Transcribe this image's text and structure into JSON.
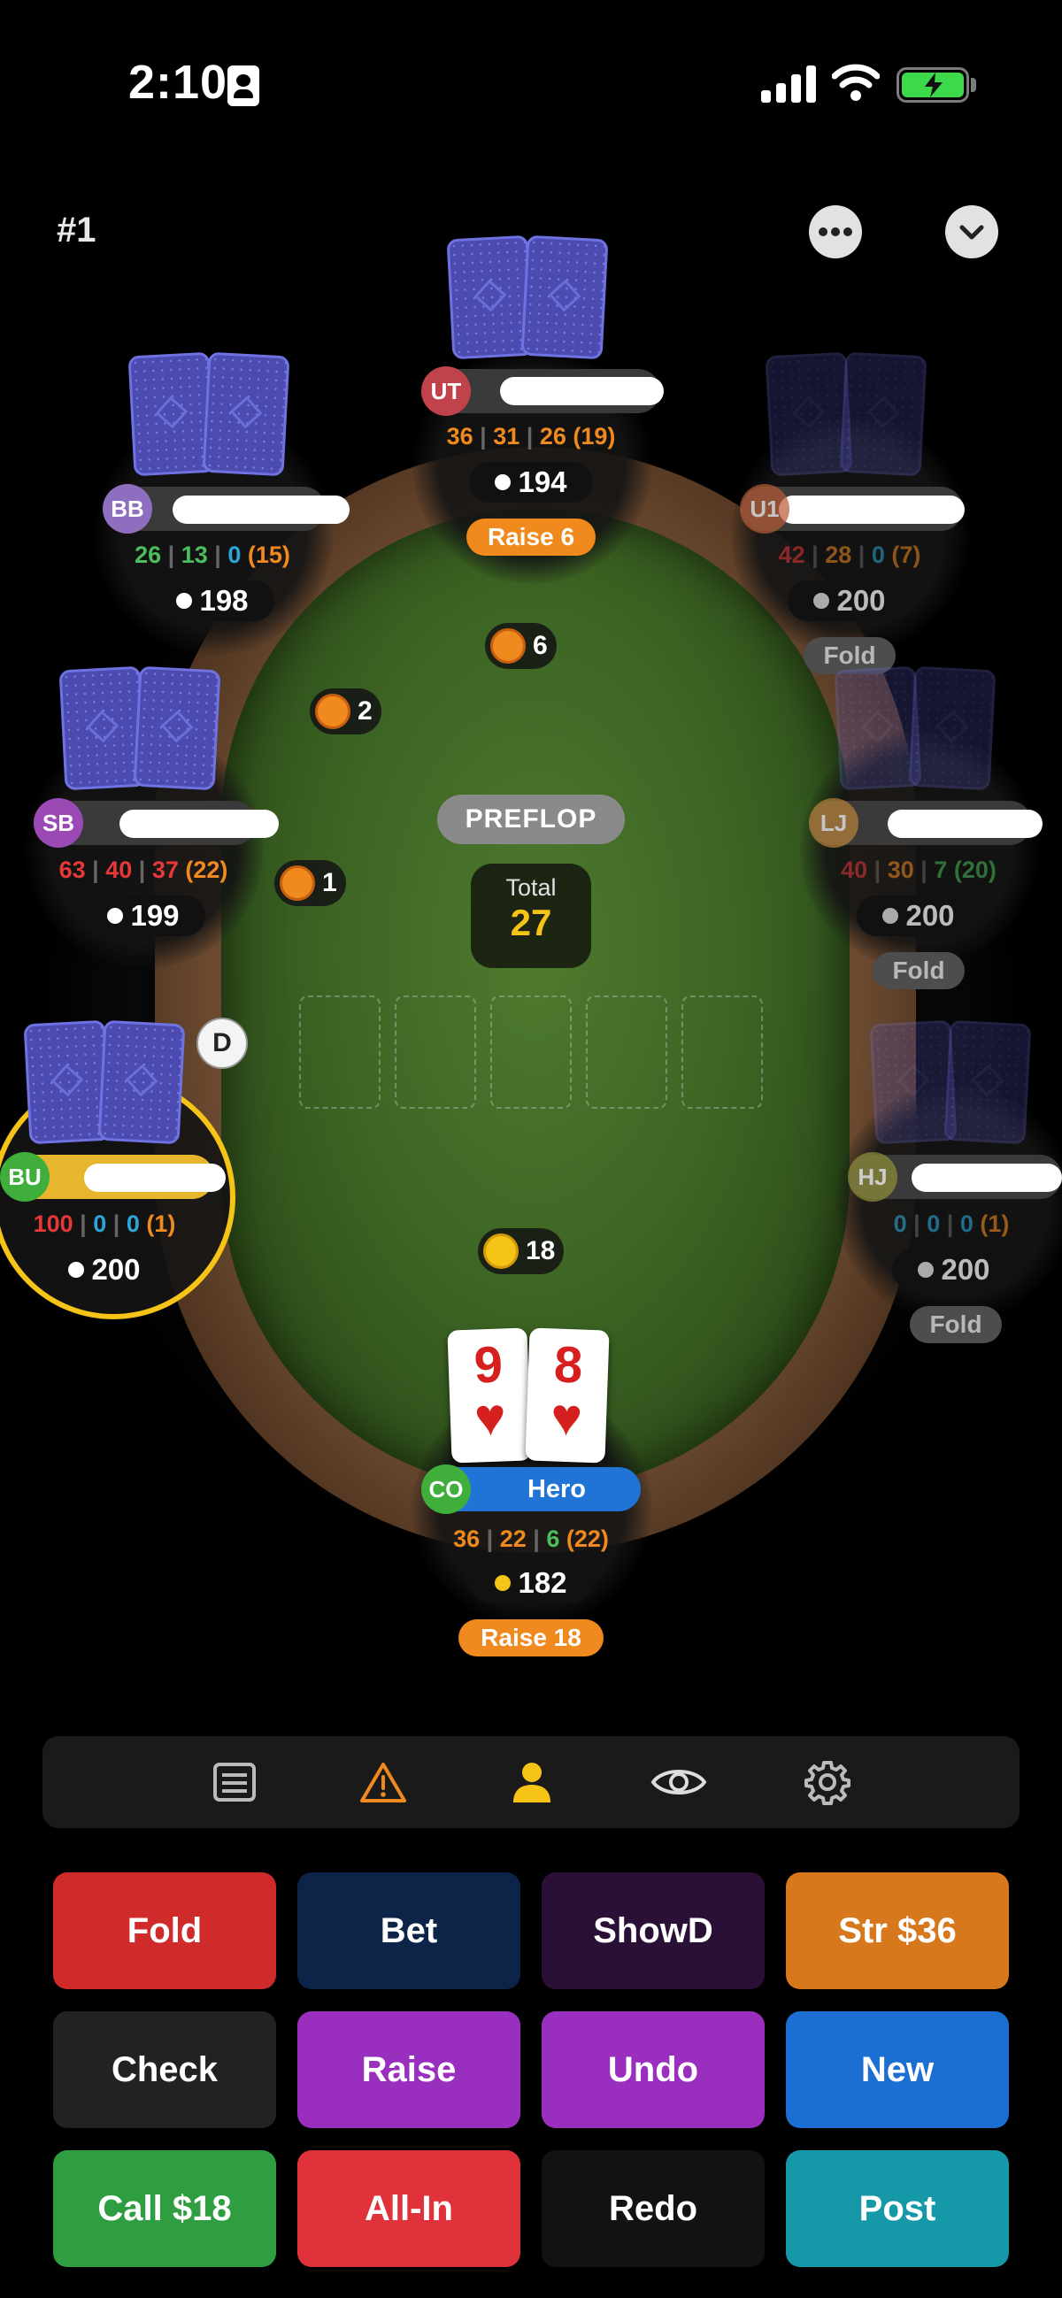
{
  "status_bar": {
    "time": "2:10",
    "battery_color": "#3cd94a"
  },
  "header": {
    "hand_number": "#1",
    "more_icon": "ellipsis-icon",
    "collapse_icon": "chevron-down-icon"
  },
  "street": "PREFLOP",
  "pot": {
    "label": "Total",
    "value": "27"
  },
  "dealer": "D",
  "seats": {
    "ut": {
      "position": "UT",
      "stats": [
        "36",
        "31",
        "26",
        "(19)"
      ],
      "stack": "194",
      "action": "Raise 6",
      "badge_color": "#c0434b"
    },
    "bb": {
      "position": "BB",
      "stats": [
        "26",
        "13",
        "0",
        "(15)"
      ],
      "stack": "198",
      "badge_color": "#8e6fbf"
    },
    "u1": {
      "position": "U1",
      "stats": [
        "42",
        "28",
        "0",
        "(7)"
      ],
      "stack": "200",
      "action": "Fold",
      "badge_color": "#b85a35"
    },
    "sb": {
      "position": "SB",
      "stats": [
        "63",
        "40",
        "37",
        "(22)"
      ],
      "stack": "199",
      "badge_color": "#9a49b5"
    },
    "lj": {
      "position": "LJ",
      "stats": [
        "40",
        "30",
        "7",
        "(20)"
      ],
      "stack": "200",
      "action": "Fold",
      "badge_color": "#b8833a"
    },
    "bu": {
      "position": "BU",
      "stats": [
        "100",
        "0",
        "0",
        "(1)"
      ],
      "stack": "200",
      "badge_color": "#3fae3a"
    },
    "hj": {
      "position": "HJ",
      "stats": [
        "0",
        "0",
        "0",
        "(1)"
      ],
      "stack": "200",
      "action": "Fold",
      "badge_color": "#8a8a3a"
    },
    "co": {
      "position": "CO",
      "name": "Hero",
      "stats": [
        "36",
        "22",
        "6",
        "(22)"
      ],
      "stack": "182",
      "action": "Raise 18",
      "badge_color": "#3fae3a",
      "cards": [
        {
          "rank": "9",
          "suit": "♥"
        },
        {
          "rank": "8",
          "suit": "♥"
        }
      ]
    }
  },
  "bets": {
    "ut": "6",
    "bb": "2",
    "sb": "1",
    "hero": "18"
  },
  "toolbar": [
    "notes-icon",
    "warning-icon",
    "person-icon",
    "eye-icon",
    "gear-icon"
  ],
  "actions": {
    "fold": "Fold",
    "bet": "Bet",
    "showdown": "ShowD",
    "straddle": "Str $36",
    "check": "Check",
    "raise": "Raise",
    "undo": "Undo",
    "new": "New",
    "call": "Call $18",
    "allin": "All-In",
    "redo": "Redo",
    "post": "Post"
  }
}
